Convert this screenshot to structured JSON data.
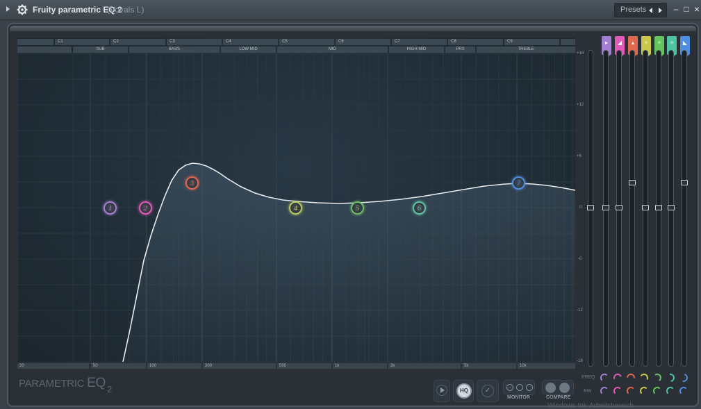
{
  "window": {
    "title": "Fruity parametric EQ 2",
    "subtitle": "(Vovals L)",
    "presets_label": "Presets",
    "minimize": "–",
    "restore": "□",
    "close": "×"
  },
  "octave_labels": [
    "",
    "C1",
    "C2",
    "C3",
    "C4",
    "C5",
    "C6",
    "C7",
    "C8",
    "C9",
    ""
  ],
  "band_labels": [
    "",
    "SUB",
    "BASS",
    "LOW MID",
    "MID",
    "HIGH MID",
    "PRS",
    "TREBLE"
  ],
  "freq_labels": [
    "20",
    "50",
    "100",
    "200",
    "500",
    "1k",
    "2k",
    "5k",
    "10k"
  ],
  "db_labels": [
    "+18",
    "+12",
    "+6",
    "0",
    "-6",
    "-12",
    "-18"
  ],
  "nodes": [
    {
      "label": "1",
      "color": "#a37fd1"
    },
    {
      "label": "2",
      "color": "#e25ab7"
    },
    {
      "label": "3",
      "color": "#e0684f"
    },
    {
      "label": "4",
      "color": "#b8c85a"
    },
    {
      "label": "5",
      "color": "#6fbc6a"
    },
    {
      "label": "6",
      "color": "#5fc0a5"
    },
    {
      "label": "7",
      "color": "#4f8ee0"
    }
  ],
  "band_colors": [
    "#a37fd1",
    "#e25ab7",
    "#e0684f",
    "#c9c84a",
    "#63c55c",
    "#4fc4a0",
    "#4f8ee0"
  ],
  "band_glyphs": [
    "▸",
    "◢",
    "▴",
    "✧",
    "✧",
    "✧",
    "◣"
  ],
  "band_levels": [
    0,
    0,
    0.6,
    0,
    0,
    0,
    0.6
  ],
  "logo": {
    "text": "PARAMETRIC ",
    "eq": "EQ",
    "two": "2"
  },
  "controls": {
    "hq_label": "HQ",
    "monitor_label": "MONITOR",
    "compare_label": "COMPARE",
    "freq_label": "FREQ",
    "bw_label": "BW"
  },
  "watermark": "Windows Ink-Arbeitsbereich"
}
